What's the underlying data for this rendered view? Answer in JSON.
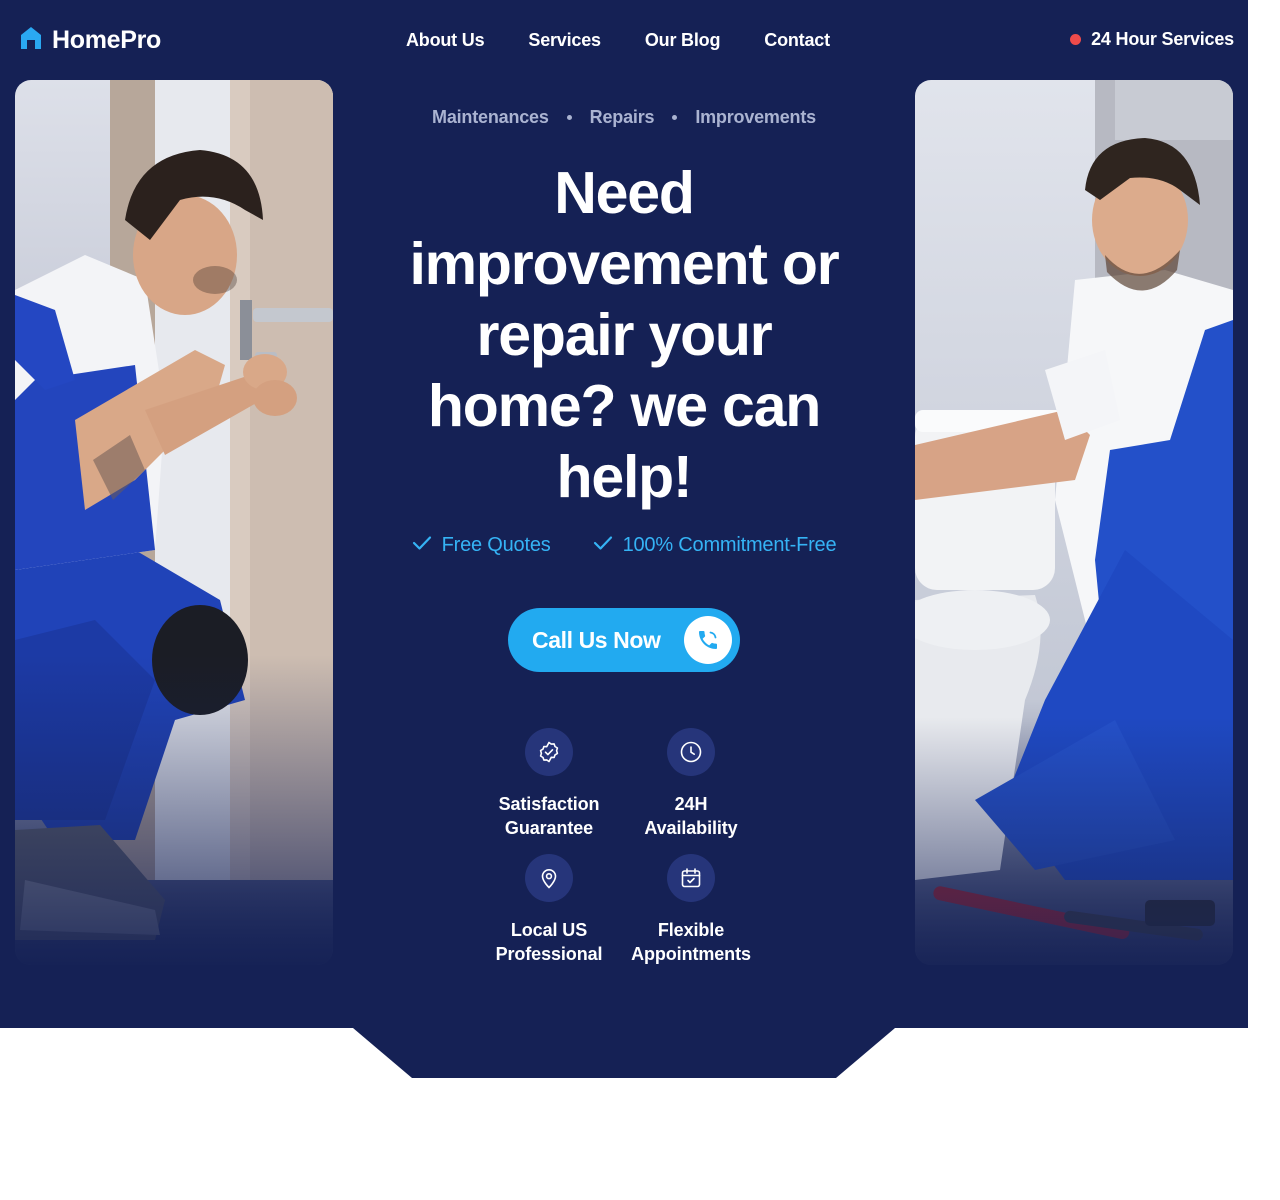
{
  "brand": {
    "name": "HomePro",
    "icon": "house-icon"
  },
  "nav": {
    "items": [
      {
        "label": "About Us"
      },
      {
        "label": "Services"
      },
      {
        "label": "Our Blog"
      },
      {
        "label": "Contact"
      }
    ]
  },
  "hours": {
    "label": "24 Hour Services",
    "dot_color": "#ee4b4b"
  },
  "hero": {
    "tags": [
      "Maintenances",
      "Repairs",
      "Improvements"
    ],
    "headline_lines": [
      "Need",
      "improvement or",
      "repair your",
      "home? we can",
      "help!"
    ],
    "checks": [
      "Free Quotes",
      "100% Commitment-Free"
    ],
    "cta": {
      "label": "Call Us Now",
      "icon": "phone-icon"
    }
  },
  "features": [
    {
      "label": "Satisfaction\nGuarantee",
      "icon": "badge-check-icon"
    },
    {
      "label": "24H\nAvailability",
      "icon": "clock-icon"
    },
    {
      "label": "Local US\nProfessional",
      "icon": "location-pin-icon"
    },
    {
      "label": "Flexible\nAppointments",
      "icon": "calendar-check-icon"
    }
  ],
  "colors": {
    "background": "#152155",
    "accent": "#22aaf0",
    "check_text": "#35b3f5",
    "icon_circle": "#26357a",
    "overall_blue": "#1f49c9"
  }
}
